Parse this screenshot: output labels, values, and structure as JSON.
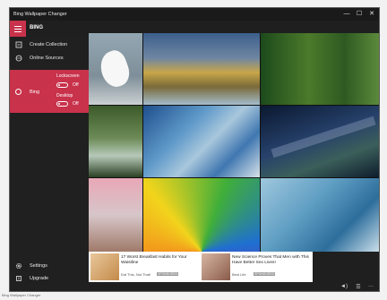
{
  "window": {
    "title": "Bing Wallpaper Changer",
    "controls": {
      "minimize": "—",
      "maximize": "☐",
      "close": "✕"
    }
  },
  "header": {
    "title": "BING"
  },
  "sidebar": {
    "items": [
      {
        "label": "Create Collection",
        "icon": "collection-icon"
      },
      {
        "label": "Online Sources",
        "icon": "globe-icon"
      },
      {
        "label": "Settings",
        "icon": "gear-icon"
      },
      {
        "label": "Upgrade",
        "icon": "upgrade-icon"
      }
    ],
    "bing": {
      "label": "Bing",
      "lockscreen_label": "Lockscreen",
      "lockscreen_state": "Off",
      "desktop_label": "Desktop",
      "desktop_state": "Off"
    }
  },
  "grid": {
    "tiles": [
      {
        "subject": "pelican"
      },
      {
        "subject": "autumn-valley"
      },
      {
        "subject": "forest"
      },
      {
        "subject": "waterfall"
      },
      {
        "subject": "ice-aerial"
      },
      {
        "subject": "milky-way"
      },
      {
        "subject": "pink-trees"
      },
      {
        "subject": "feathers"
      },
      {
        "subject": "frozen-waves"
      }
    ]
  },
  "ads": [
    {
      "title": "17 Worst Breakfast Habits for Your Waistline",
      "source": "Eat This, Not That!",
      "badge": "SPONSORED"
    },
    {
      "title": "New Science Proves That Men with This Have Better Sex Lives!",
      "source": "Best Life",
      "badge": "SPONSORED"
    }
  ],
  "bottombar": {
    "sound": "◄)",
    "list": "☰",
    "more": "···"
  },
  "colors": {
    "accent": "#c8324b",
    "bg": "#1f1f1f"
  },
  "status_caption": "Bing Wallpaper Changer"
}
